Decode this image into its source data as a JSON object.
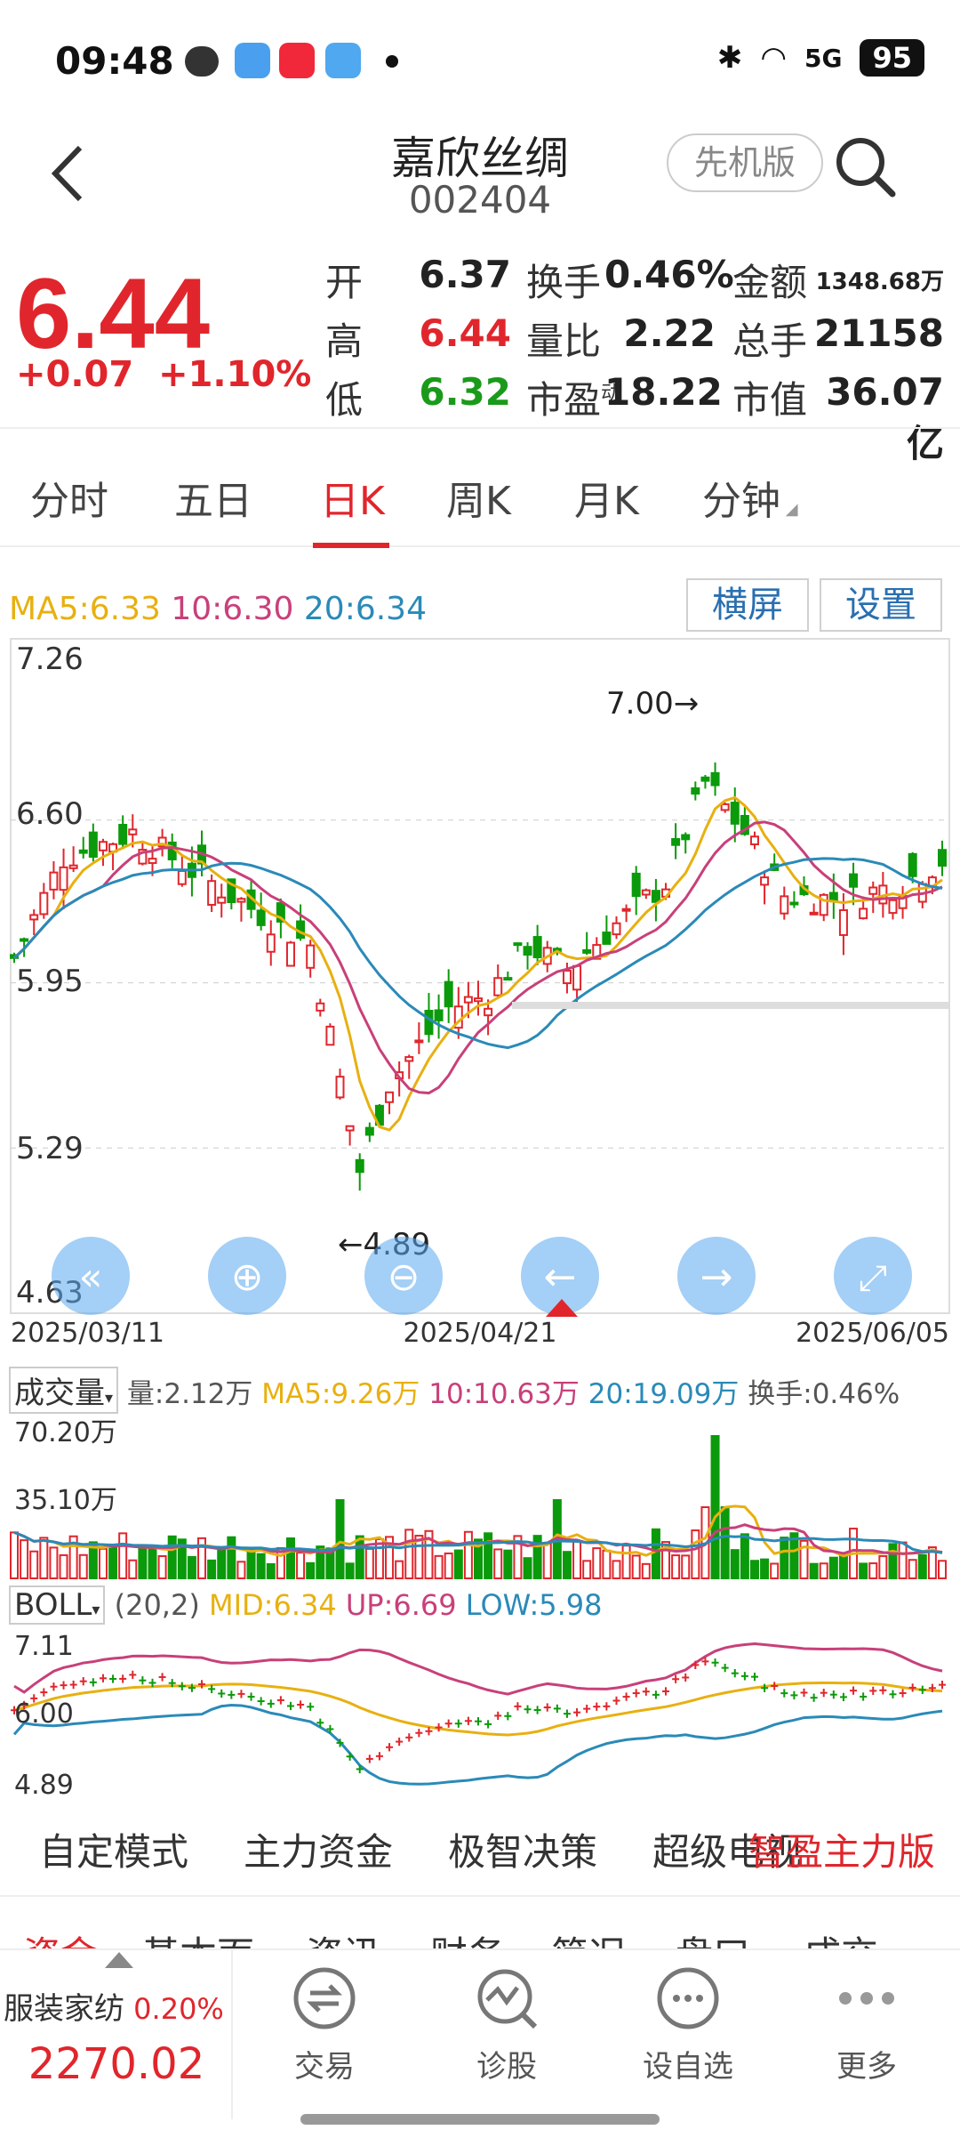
{
  "status": {
    "time": "09:48",
    "battery": "95",
    "net": "5G"
  },
  "header": {
    "title": "嘉欣丝绸",
    "code": "002404",
    "mode_button": "先机版"
  },
  "quote": {
    "price": "6.44",
    "change": "+0.07",
    "change_pct": "+1.10%",
    "rows": [
      [
        {
          "label": "开",
          "value": "6.37",
          "color": "#222"
        },
        {
          "label": "换手",
          "value": "0.46%"
        },
        {
          "label": "金额",
          "value": "1348.68万"
        }
      ],
      [
        {
          "label": "高",
          "value": "6.44",
          "color": "#e0262c"
        },
        {
          "label": "量比",
          "value": "2.22"
        },
        {
          "label": "总手",
          "value": "21158"
        }
      ],
      [
        {
          "label": "低",
          "value": "6.32",
          "color": "#1a9a1a"
        },
        {
          "label": "市盈",
          "sup": "动",
          "value": "18.22"
        },
        {
          "label": "市值",
          "value": "36.07亿"
        }
      ]
    ]
  },
  "tabs": [
    "分时",
    "五日",
    "日K",
    "周K",
    "月K",
    "分钟"
  ],
  "active_tab": "日K",
  "kline": {
    "ma_legend": {
      "ma5": "MA5:6.33",
      "ma10": "10:6.30",
      "ma20": "20:6.34"
    },
    "buttons": {
      "landscape": "横屏",
      "settings": "设置"
    },
    "y_labels": [
      "7.26",
      "6.60",
      "5.95",
      "5.29",
      "4.63"
    ],
    "x_labels": [
      "2025/03/11",
      "2025/04/21",
      "2025/06/05"
    ],
    "high_marker": "7.00→",
    "low_marker": "←4.89",
    "colors": {
      "up": "#e0262c",
      "down": "#0b9a0b",
      "ma5": "#e8b010",
      "ma10": "#c8407a",
      "ma20": "#2a8ab8"
    }
  },
  "volume": {
    "selector": "成交量",
    "vol": "量:2.12万",
    "ma5": "MA5:9.26万",
    "ma10": "10:10.63万",
    "ma20": "20:19.09万",
    "turnover": "换手:0.46%",
    "y_labels": [
      "70.20万",
      "35.10万"
    ]
  },
  "boll": {
    "selector": "BOLL",
    "params": "(20,2)",
    "mid": "MID:6.34",
    "up": "UP:6.69",
    "low": "LOW:5.98",
    "y_labels": [
      "7.11",
      "6.00",
      "4.89"
    ]
  },
  "chart_data": {
    "type": "candlestick",
    "x_range": [
      "2025/03/11",
      "2025/06/05"
    ],
    "ylim": [
      4.63,
      7.26
    ],
    "high": 7.0,
    "low": 4.89,
    "last": {
      "open": 6.37,
      "high": 6.44,
      "low": 6.32,
      "close": 6.44
    },
    "series": [
      {
        "name": "MA5",
        "last": 6.33
      },
      {
        "name": "10",
        "last": 6.3
      },
      {
        "name": "20",
        "last": 6.34
      }
    ],
    "volume": {
      "ylim_top": "70.20万",
      "mid": "35.10万",
      "last": "2.12万"
    },
    "boll": {
      "mid": 6.34,
      "up": 6.69,
      "low": 5.98
    }
  },
  "functions": [
    "自定模式",
    "主力资金",
    "极智决策",
    "超级电视"
  ],
  "func_overlay": "智盈主力版",
  "subtabs": [
    "资金",
    "基本面",
    "资讯",
    "财务",
    "简况",
    "盘口",
    "成交"
  ],
  "bottom": {
    "sector": "服装家纺",
    "sector_pct": "0.20%",
    "sector_index": "2270.02",
    "items": [
      "交易",
      "诊股",
      "设自选",
      "更多"
    ]
  }
}
